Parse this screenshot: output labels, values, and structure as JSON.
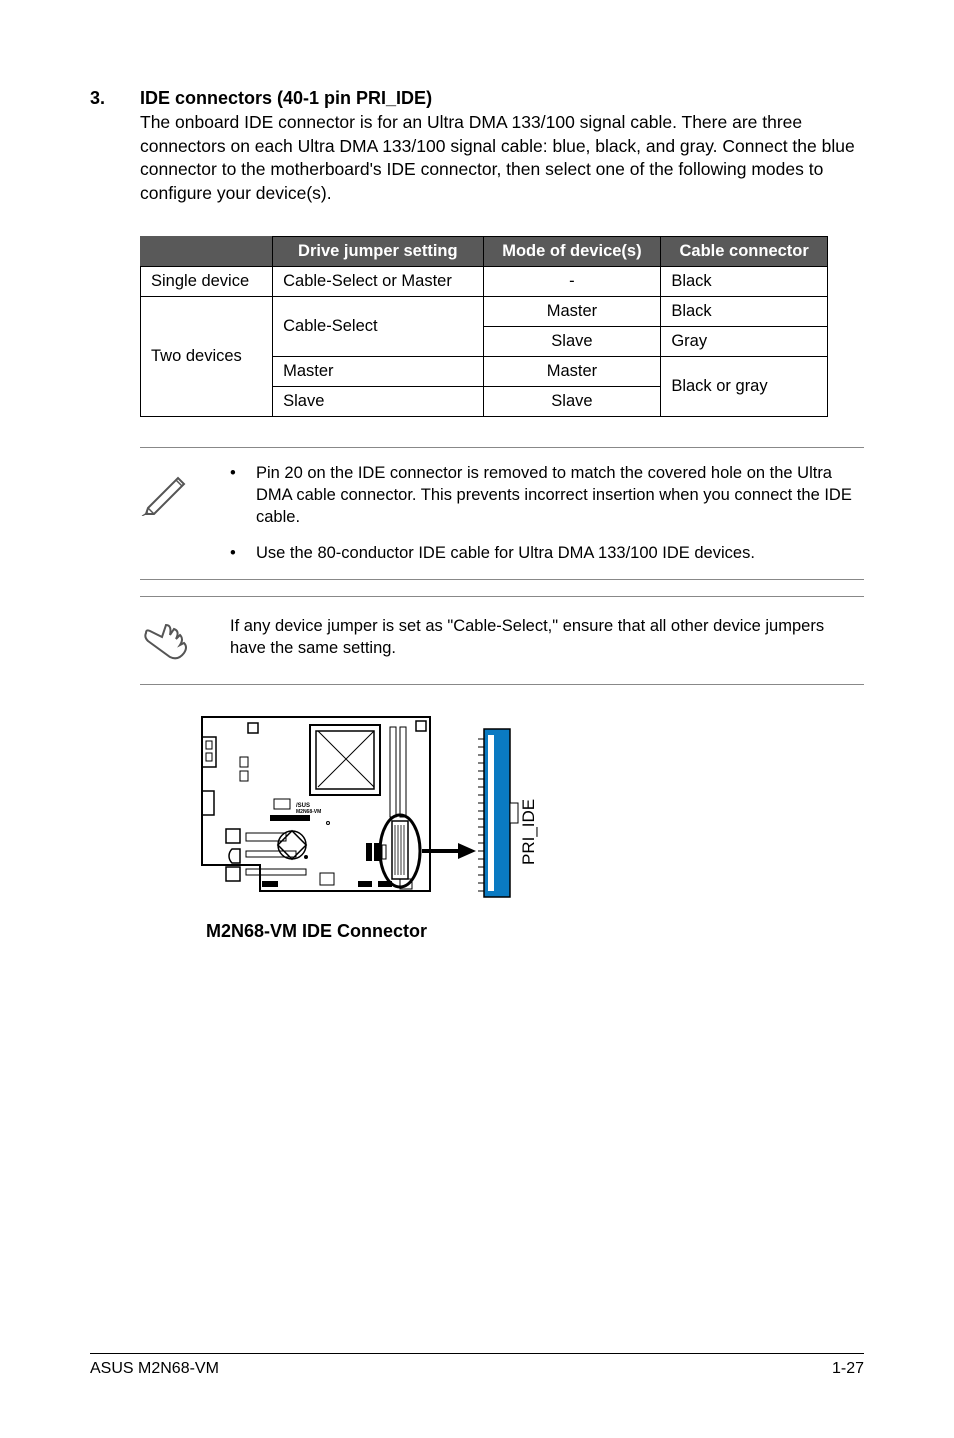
{
  "section": {
    "number": "3.",
    "title": "IDE connectors (40-1 pin PRI_IDE)",
    "text": "The onboard IDE connector is for an Ultra DMA 133/100 signal cable. There are three connectors on each Ultra DMA 133/100 signal cable: blue, black, and gray. Connect the blue connector to the motherboard's IDE connector, then select one of the following modes to configure your device(s)."
  },
  "table": {
    "headers": [
      "Drive jumper setting",
      "Mode of device(s)",
      "Cable connector"
    ],
    "row1": {
      "label": "Single device",
      "jumper": "Cable-Select or Master",
      "mode": "-",
      "cable": "Black"
    },
    "row2": {
      "label": "Two devices",
      "jumper": "Cable-Select",
      "mode1": "Master",
      "cable1": "Black",
      "mode2": "Slave",
      "cable2": "Gray",
      "jumper2": "Master",
      "mode3": "Master",
      "cable3": "Black or gray",
      "jumper3": "Slave",
      "mode4": "Slave"
    }
  },
  "note1": {
    "item1": "Pin 20 on the IDE connector is removed to match the covered hole on the Ultra DMA cable connector. This prevents incorrect insertion when you connect the IDE cable.",
    "item2": "Use the 80-conductor IDE cable for Ultra DMA 133/100 IDE devices."
  },
  "note2": {
    "text": "If any device jumper is set as \"Cable-Select,\" ensure that all other device jumpers have the same setting."
  },
  "diagram": {
    "board_label": "M2N68-VM",
    "connector_label": "PRI_IDE",
    "caption": "M2N68-VM IDE Connector"
  },
  "footer": {
    "left": "ASUS M2N68-VM",
    "right": "1-27"
  }
}
